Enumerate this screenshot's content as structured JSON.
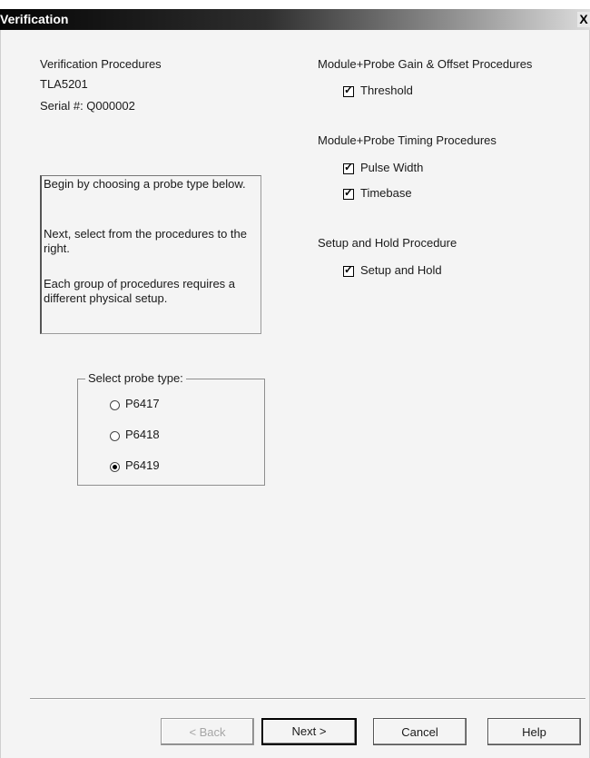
{
  "window": {
    "title": "Verification",
    "close_glyph": "X"
  },
  "left": {
    "heading": "Verification Procedures",
    "model": "TLA5201",
    "serial": "Serial #: Q000002",
    "instructions": [
      "Begin by choosing a probe type below.",
      "Next, select from the procedures to the right.",
      "Each group of procedures requires a different physical setup."
    ],
    "probe_group": {
      "label": "Select probe type:",
      "options": [
        "P6417",
        "P6418",
        "P6419"
      ],
      "selected": "P6419"
    }
  },
  "right": {
    "gain_heading": "Module+Probe Gain & Offset Procedures",
    "gain_items": [
      "Threshold"
    ],
    "timing_heading": "Module+Probe Timing Procedures",
    "timing_items": [
      "Pulse Width",
      "Timebase"
    ],
    "setup_heading": "Setup and Hold Procedure",
    "setup_items": [
      "Setup and Hold"
    ],
    "all_checked": true
  },
  "buttons": {
    "back": "< Back",
    "next": "Next >",
    "cancel": "Cancel",
    "help": "Help"
  }
}
